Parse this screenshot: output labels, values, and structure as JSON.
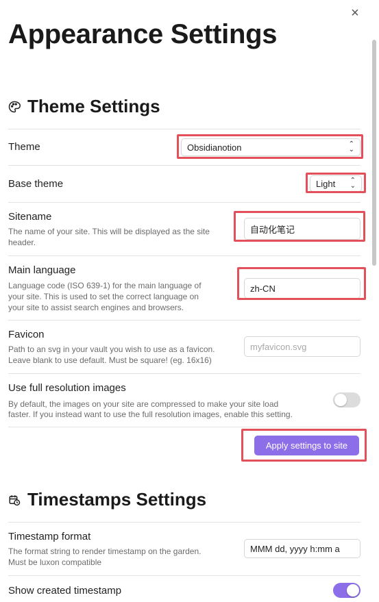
{
  "page": {
    "title": "Appearance Settings",
    "close_icon": "×"
  },
  "theme_section": {
    "title": "Theme Settings",
    "icon": "palette-icon",
    "theme": {
      "name": "Theme",
      "value": "Obsidianotion"
    },
    "base_theme": {
      "name": "Base theme",
      "value": "Light"
    },
    "sitename": {
      "name": "Sitename",
      "desc_line1": "The name of your site. This will be displayed as the site",
      "desc_line2": "header.",
      "value": "自动化笔记"
    },
    "language": {
      "name": "Main language",
      "desc_line1": "Language code (ISO 639-1) for the main language of",
      "desc_line2": "your site. This is used to set the correct language on",
      "desc_line3": "your site to assist search engines and browsers.",
      "value": "zh-CN"
    },
    "favicon": {
      "name": "Favicon",
      "desc_line1": "Path to an svg in your vault you wish to use as a favicon.",
      "desc_line2": "Leave blank to use default. Must be square! (eg. 16x16)",
      "placeholder": "myfavicon.svg"
    },
    "full_res": {
      "name": "Use full resolution images",
      "desc_line1": "By default, the images on your site are compressed to make your site load",
      "desc_line2": "faster. If you instead want to use the full resolution images, enable this setting.",
      "enabled": false
    },
    "apply_button": "Apply settings to site"
  },
  "timestamps_section": {
    "title": "Timestamps Settings",
    "icon": "calendar-clock-icon",
    "format": {
      "name": "Timestamp format",
      "desc_line1": "The format string to render timestamp on the garden.",
      "desc_line2": "Must be luxon compatible",
      "value": "MMM dd, yyyy h:mm a"
    },
    "show_created": {
      "name": "Show created timestamp",
      "enabled": true
    }
  },
  "colors": {
    "accent": "#8c6ee8",
    "highlight": "#e4505a"
  }
}
